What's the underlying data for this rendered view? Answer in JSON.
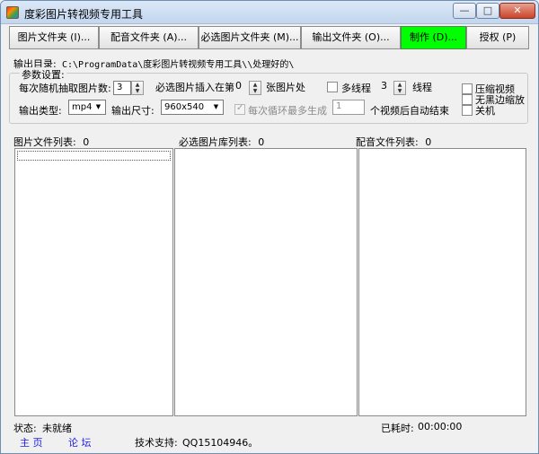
{
  "window": {
    "title": "度彩图片转视频专用工具"
  },
  "toolbar": {
    "image_folder": "图片文件夹 (I)...",
    "audio_folder": "配音文件夹 (A)...",
    "required_image_folder": "必选图片文件夹 (M)...",
    "output_folder": "输出文件夹 (O)...",
    "make": "制作 (D)...",
    "license": "授权 (P)"
  },
  "output_dir": {
    "label": "输出目录:",
    "path": "C:\\ProgramData\\度彩图片转视频专用工具\\\\处理好的\\"
  },
  "params": {
    "group_title": "参数设置:",
    "random_count_label": "每次随机抽取图片数:",
    "random_count_value": "3",
    "insert_at_label": "必选图片插入在第",
    "insert_at_value": "0",
    "insert_at_suffix": "张图片处",
    "multithread_label": "多线程",
    "thread_count_value": "3",
    "thread_suffix": "线程",
    "compress_video_label": "压缩视频",
    "no_black_border_label": "无黑边缩放",
    "shutdown_label": "关机",
    "output_type_label": "输出类型:",
    "output_type_value": "mp4",
    "output_size_label": "输出尺寸:",
    "output_size_value": "960x540",
    "max_per_loop_label": "每次循环最多生成",
    "max_per_loop_value": "1",
    "auto_end_suffix": "个视频后自动结束"
  },
  "lists": {
    "images_label": "图片文件列表:",
    "images_count": "0",
    "required_label": "必选图片库列表:",
    "required_count": "0",
    "audio_label": "配音文件列表:",
    "audio_count": "0"
  },
  "status": {
    "label": "状态:",
    "value": "未就绪",
    "elapsed_label": "已耗时:",
    "elapsed_value": "00:00:00",
    "home_link": "主 页",
    "forum_link": "论 坛",
    "support_label": "技术支持:",
    "support_value": "QQ15104946。"
  }
}
